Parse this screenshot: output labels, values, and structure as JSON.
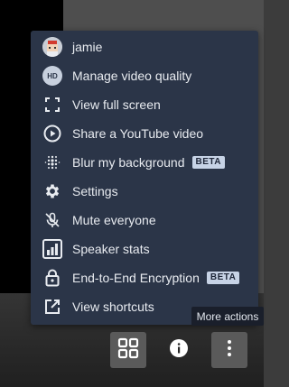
{
  "menu": {
    "items": [
      {
        "label": "jamie",
        "icon": "user-avatar-icon"
      },
      {
        "label": "Manage video quality",
        "icon": "hd-icon",
        "icon_text": "HD"
      },
      {
        "label": "View full screen",
        "icon": "fullscreen-icon"
      },
      {
        "label": "Share a YouTube video",
        "icon": "play-circle-icon"
      },
      {
        "label": "Blur my background",
        "icon": "blur-icon",
        "badge": "BETA"
      },
      {
        "label": "Settings",
        "icon": "gear-icon"
      },
      {
        "label": "Mute everyone",
        "icon": "mic-off-icon"
      },
      {
        "label": "Speaker stats",
        "icon": "stats-icon"
      },
      {
        "label": "End-to-End Encryption",
        "icon": "lock-icon",
        "badge": "BETA"
      },
      {
        "label": "View shortcuts",
        "icon": "external-link-icon"
      }
    ]
  },
  "tooltip": {
    "text": "More actions"
  },
  "toolbar": {
    "buttons": [
      {
        "name": "tile-view",
        "icon": "grid-icon"
      },
      {
        "name": "info",
        "icon": "info-icon"
      },
      {
        "name": "more-actions",
        "icon": "more-vertical-icon"
      }
    ]
  },
  "colors": {
    "menu_bg": "#2b3548",
    "badge_bg": "#c7d3e6",
    "text": "#e8ebf0"
  }
}
